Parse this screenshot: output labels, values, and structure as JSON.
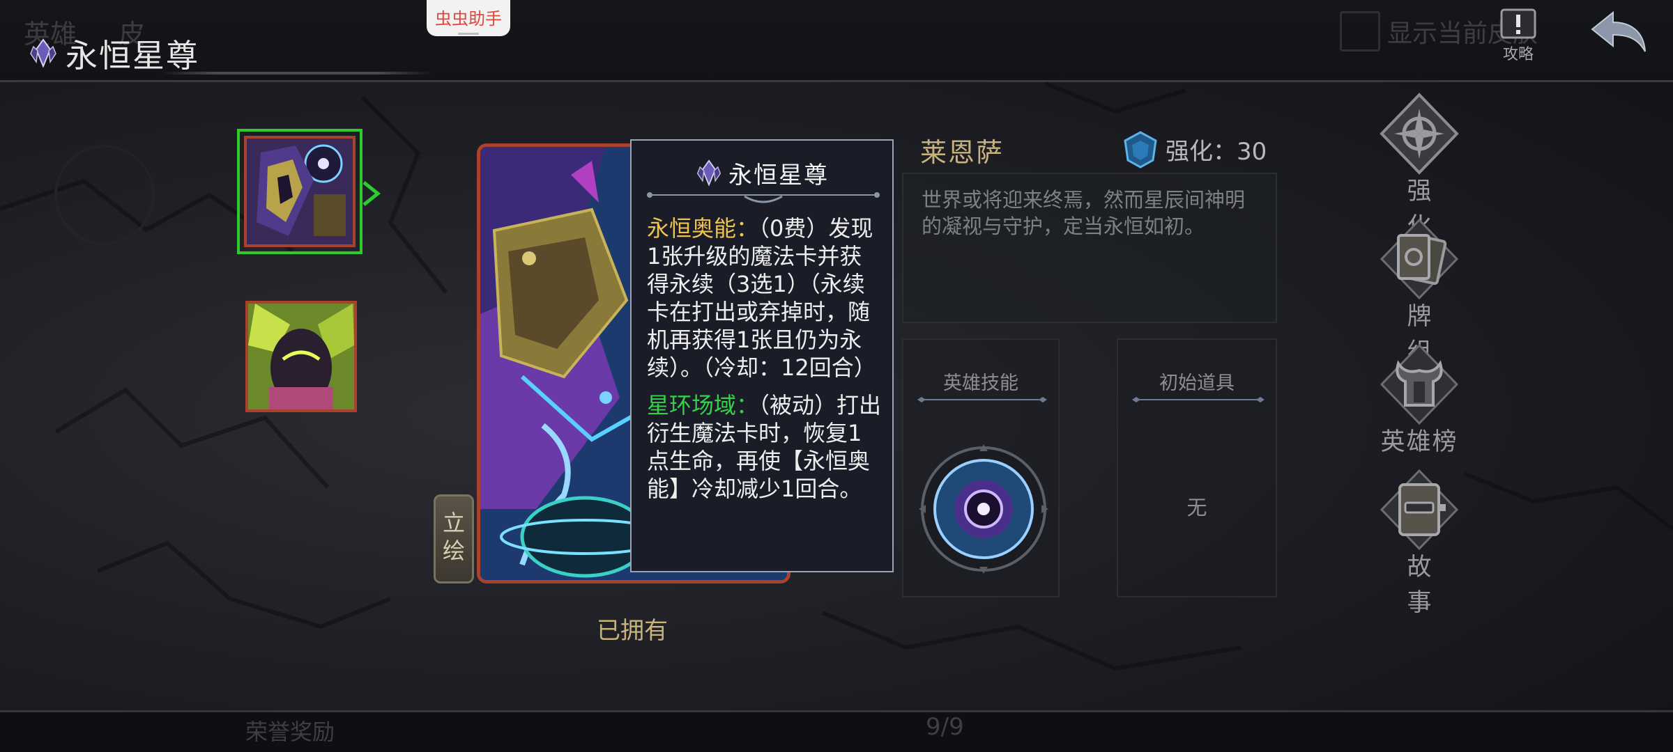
{
  "topbar": {
    "ghost_tabs": [
      "英雄",
      "皮"
    ],
    "title": "永恒星尊",
    "show_current_skin": "显示当前皮肤",
    "guide_label": "攻略"
  },
  "assistant": {
    "label": "虫虫助手"
  },
  "card": {
    "lihui_label": "立绘",
    "owned_label": "已拥有"
  },
  "tooltip": {
    "title": "永恒星尊",
    "skill1_name": "永恒奥能：",
    "skill1_text": "（0费）发现1张升级的魔法卡并获得永续（3选1）（永续卡在打出或弃掉时，随机再获得1张且仍为永续）。（冷却：12回合）",
    "skill2_name": "星环场域：",
    "skill2_text": "（被动）打出衍生魔法卡时，恢复1点生命，再使【永恒奥能】冷却减少1回合。"
  },
  "hero": {
    "name": "莱恩萨",
    "enhance_label": "强化：30",
    "description": "世界或将迎来终焉，然而星辰间神明的凝视与守护，定当永恒如初。",
    "skill_panel_title": "英雄技能",
    "item_panel_title": "初始道具",
    "item_none": "无"
  },
  "menu": {
    "enhance": "强化",
    "deck": "牌组",
    "leaderboard": "英雄榜",
    "story": "故事"
  },
  "bottom": {
    "honor_reward": "荣誉奖励",
    "pager": "9/9"
  },
  "colors": {
    "accent_gold": "#c8b27e",
    "skill_yellow": "#f0c44c",
    "skill_green": "#36d04a",
    "frame_red": "#a9412d",
    "select_green": "#2dcc2d"
  }
}
